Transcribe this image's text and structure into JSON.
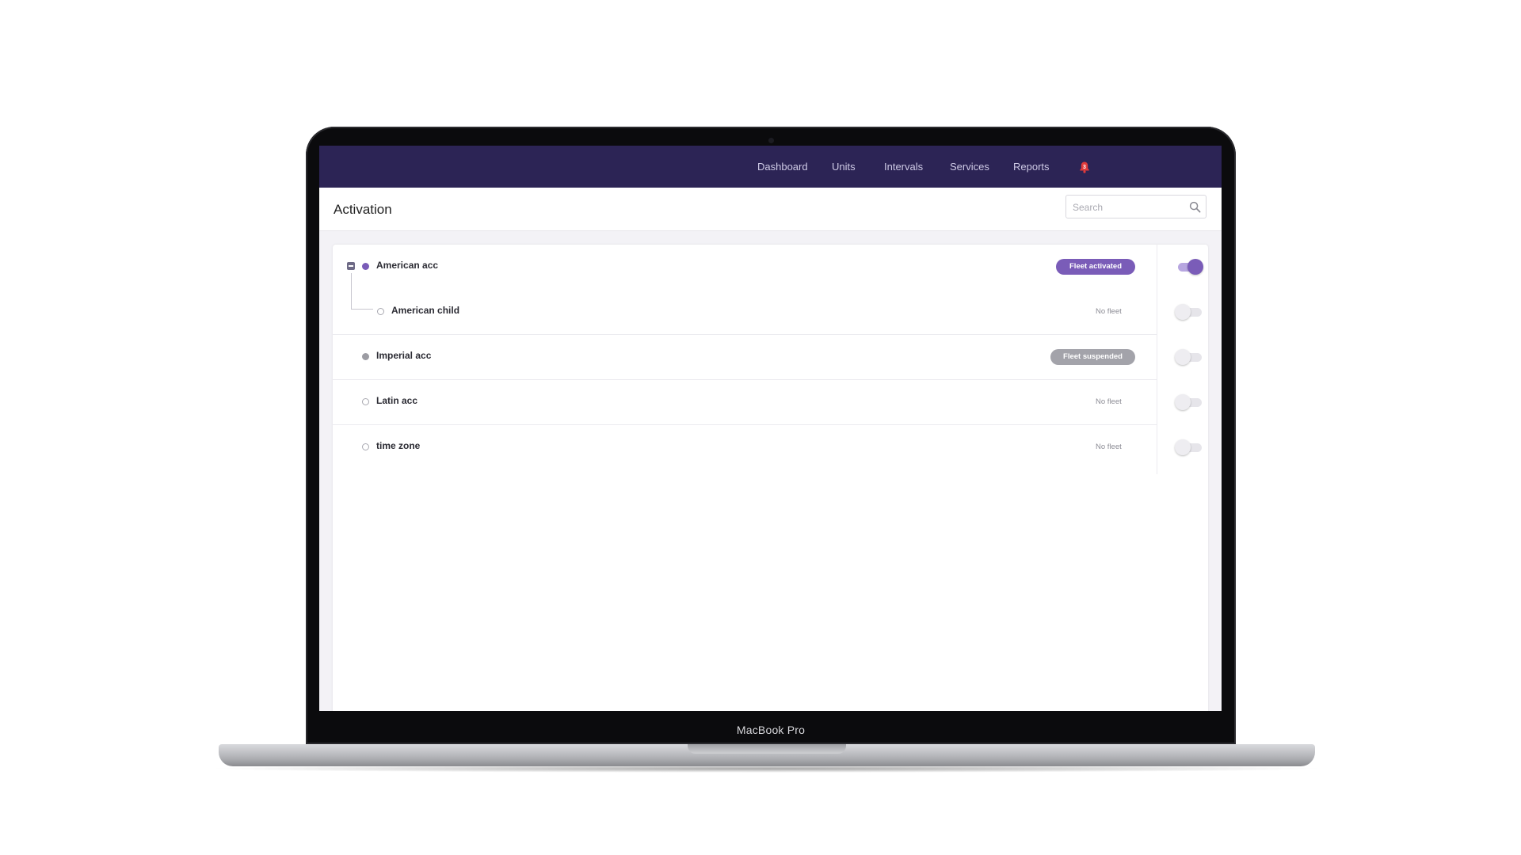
{
  "device": {
    "label": "MacBook Pro"
  },
  "nav": {
    "items": [
      {
        "label": "Dashboard"
      },
      {
        "label": "Units"
      },
      {
        "label": "Intervals"
      },
      {
        "label": "Services"
      },
      {
        "label": "Reports"
      }
    ],
    "notifications": {
      "count": "3",
      "icon": "bell-icon",
      "color": "#e03b3b"
    }
  },
  "header": {
    "title": "Activation",
    "search": {
      "placeholder": "Search",
      "value": ""
    }
  },
  "accounts": [
    {
      "name": "American acc",
      "status": "Fleet activated",
      "toggle_on": true,
      "expanded": true,
      "children": [
        {
          "name": "American child",
          "status": "No fleet",
          "toggle_on": false
        }
      ]
    },
    {
      "name": "Imperial acc",
      "status": "Fleet suspended",
      "toggle_on": false
    },
    {
      "name": "Latin acc",
      "status": "No fleet",
      "toggle_on": false
    },
    {
      "name": "time zone",
      "status": "No fleet",
      "toggle_on": false
    }
  ],
  "colors": {
    "nav_bg": "#2c2455",
    "accent": "#7a5cb8",
    "suspended": "#a3a3aa"
  }
}
